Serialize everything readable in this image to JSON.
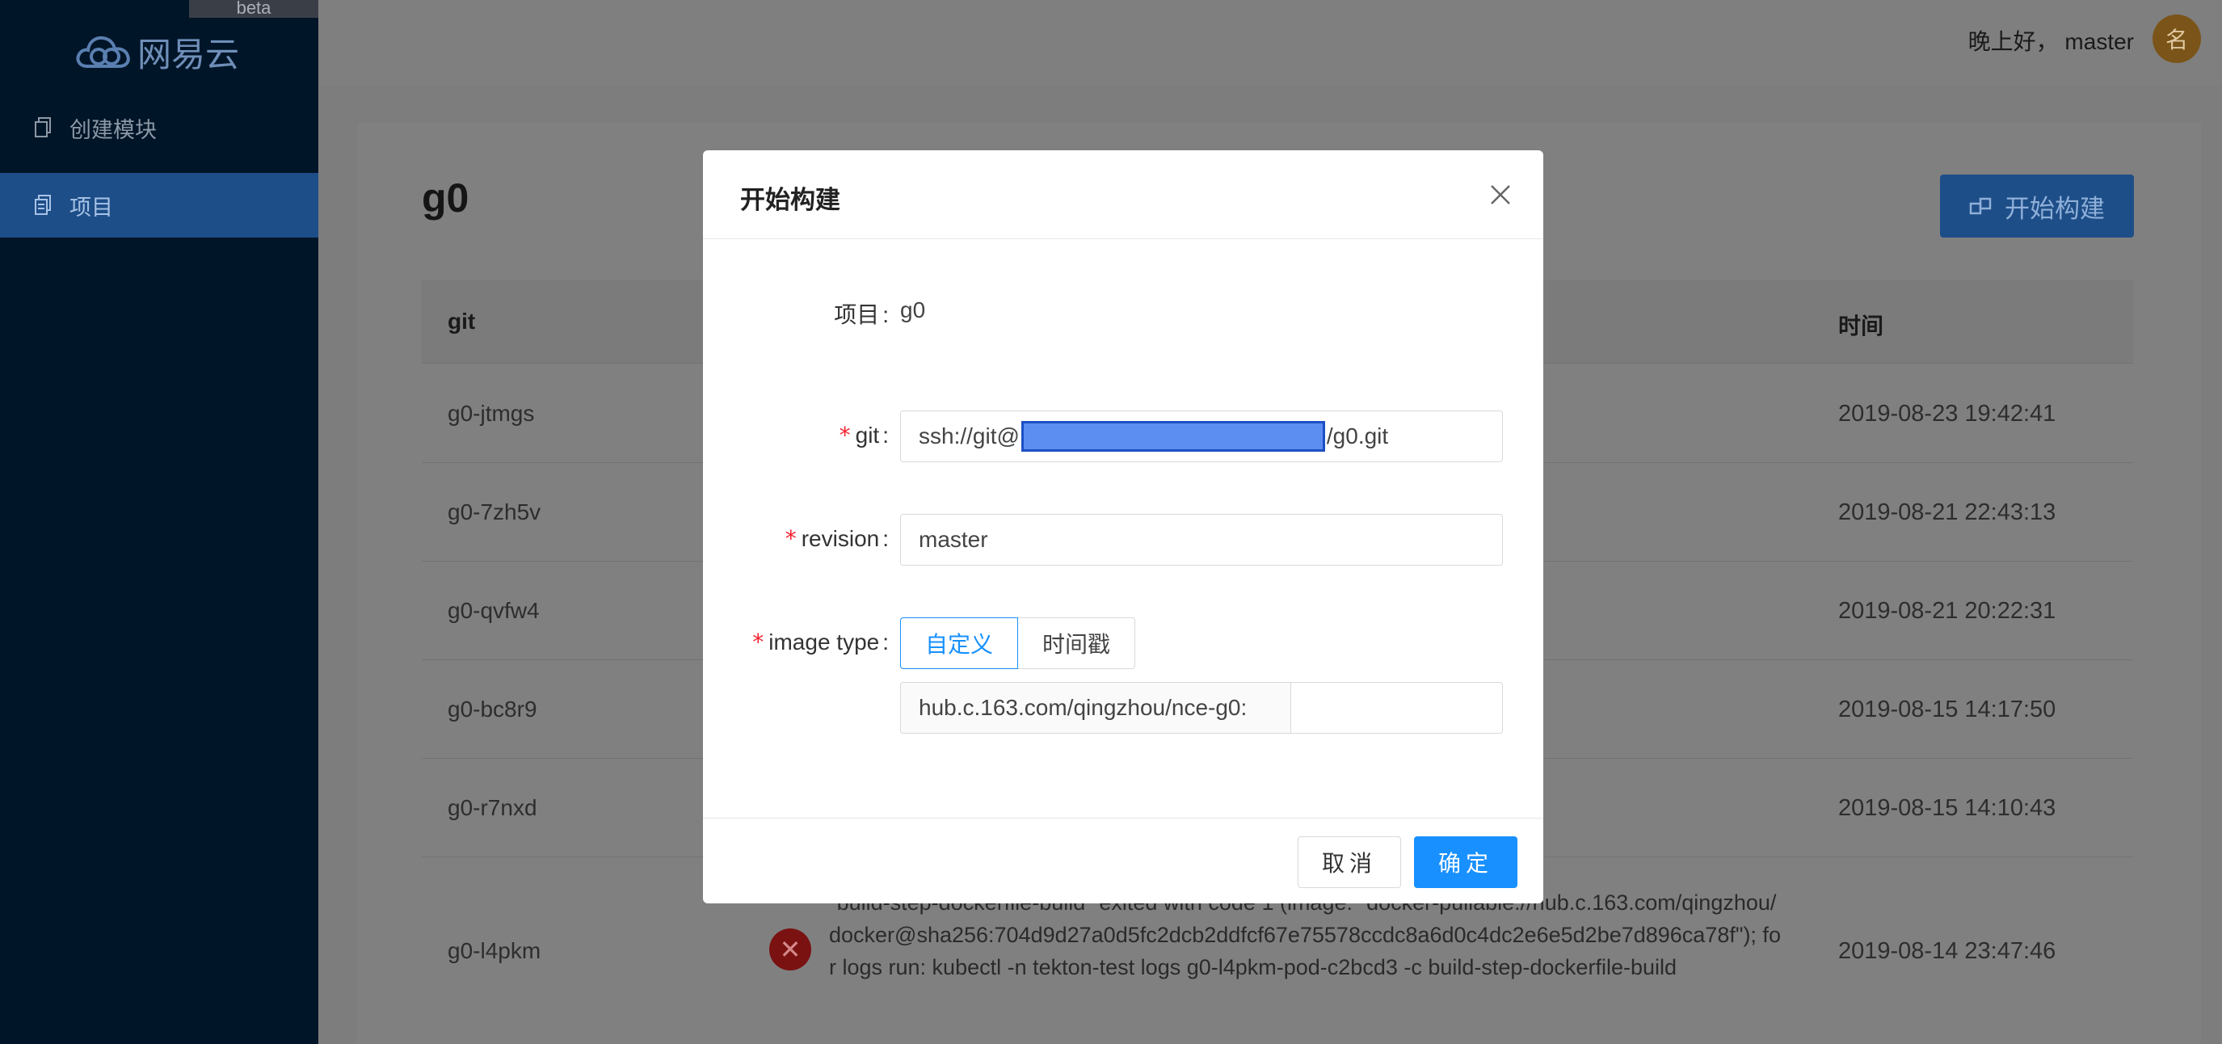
{
  "sidebar": {
    "beta_label": "beta",
    "logo_text": "网易云",
    "items": [
      {
        "label": "创建模块",
        "icon": "copy-icon",
        "active": false
      },
      {
        "label": "项目",
        "icon": "document-icon",
        "active": true
      }
    ]
  },
  "header": {
    "greeting": "晚上好， master",
    "avatar_text": "名"
  },
  "page": {
    "title": "g0",
    "start_build_label": "开始构建",
    "columns": {
      "git": "git",
      "time": "时间"
    },
    "rows": [
      {
        "git": "g0-jtmgs",
        "time": "2019-08-23 19:42:41"
      },
      {
        "git": "g0-7zh5v",
        "time": "2019-08-21 22:43:13"
      },
      {
        "git": "g0-qvfw4",
        "time": "2019-08-21 20:22:31"
      },
      {
        "git": "g0-bc8r9",
        "time": "2019-08-15 14:17:50"
      },
      {
        "git": "g0-r7nxd",
        "time": "2019-08-15 14:10:43"
      },
      {
        "git": "g0-l4pkm",
        "time": "2019-08-14 23:47:46",
        "message": "\"build-step-dockerfile-build\" exited with code 1 (image: \"docker-pullable://hub.c.163.com/qingzhou/docker@sha256:704d9d27a0d5fc2dcb2ddfcf67e75578ccdc8a6d0c4dc2e6e5d2be7d896ca78f\"); for logs run: kubectl -n tekton-test logs g0-l4pkm-pod-c2bcd3 -c build-step-dockerfile-build"
      }
    ]
  },
  "modal": {
    "title": "开始构建",
    "project_label": "项目",
    "project_value": "g0",
    "git_label": "git",
    "git_prefix": "ssh://git@",
    "git_suffix": "/g0.git",
    "revision_label": "revision",
    "revision_value": "master",
    "image_type_label": "image type",
    "image_type_options": [
      "自定义",
      "时间戳"
    ],
    "image_type_selected": "自定义",
    "image_prefix": "hub.c.163.com/qingzhou/nce-g0:",
    "image_tag_value": "",
    "cancel_label": "取消",
    "ok_label": "确定",
    "colon": ":"
  },
  "colors": {
    "primary": "#1890ff",
    "sidebar_bg": "#011528",
    "required": "#f5222d"
  }
}
